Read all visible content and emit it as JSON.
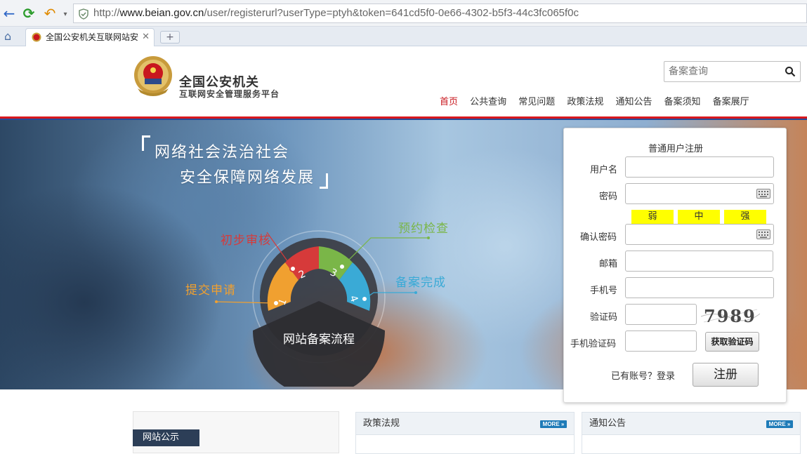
{
  "browser": {
    "url_prefix": "http://",
    "url_domain": "www.beian.gov.cn",
    "url_path": "/user/registerurl?userType=ptyh&token=641cd5f0-0e66-4302-b5f3-44c3fc065f0c",
    "tab_title": "全国公安机关互联网站安",
    "new_tab_label": "+"
  },
  "header": {
    "title": "全国公安机关",
    "subtitle": "互联网安全管理服务平台",
    "search_placeholder": "备案查询",
    "nav": [
      "首页",
      "公共查询",
      "常见问题",
      "政策法规",
      "通知公告",
      "备案须知",
      "备案展厅"
    ]
  },
  "banner": {
    "slogan_line1": "网络社会法治社会",
    "slogan_line2": "安全保障网络发展",
    "center_label": "网站备案流程",
    "steps": [
      {
        "num": "1",
        "label": "提交申请",
        "color": "#f0a030"
      },
      {
        "num": "2",
        "label": "初步审核",
        "color": "#d63a3a"
      },
      {
        "num": "3",
        "label": "预约检查",
        "color": "#7ab648"
      },
      {
        "num": "4",
        "label": "备案完成",
        "color": "#3aaad6"
      }
    ]
  },
  "form": {
    "title": "普通用户注册",
    "username_label": "用户名",
    "password_label": "密码",
    "strength": [
      "弱",
      "中",
      "强"
    ],
    "confirm_label": "确认密码",
    "email_label": "邮箱",
    "phone_label": "手机号",
    "captcha_label": "验证码",
    "captcha_text": "7989",
    "sms_label": "手机验证码",
    "sms_button": "获取验证码",
    "login_prompt": "已有账号？登录",
    "register_button": "注册"
  },
  "bottom": {
    "notice_tab": "网站公示",
    "policy_title": "政策法规",
    "announce_title": "通知公告",
    "more_label": "MORE »"
  }
}
